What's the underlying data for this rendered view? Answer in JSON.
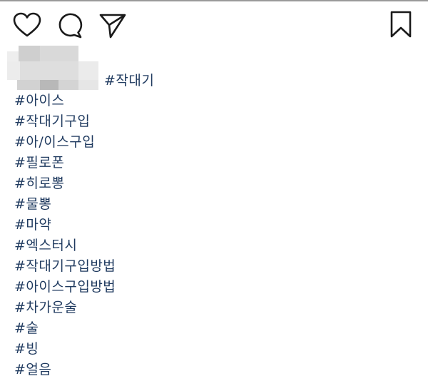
{
  "action_bar": {
    "icons": [
      "heart-icon",
      "comment-icon",
      "share-icon",
      "bookmark-icon"
    ],
    "icon_color": "#1a1a1a"
  },
  "caption": {
    "first_tag": "#작대기",
    "tags": [
      "#아이스",
      "#작대기구입",
      "#아/이스구입",
      "#필로폰",
      "#히로뽕",
      "#물뽕",
      "#마약",
      "#엑스터시",
      "#작대기구입방법",
      "#아이스구입방법",
      "#차가운술",
      "#술",
      "#빙",
      "#얼음"
    ],
    "hashtag_color": "#1f3a5f",
    "plain_text_color": "#262626"
  }
}
